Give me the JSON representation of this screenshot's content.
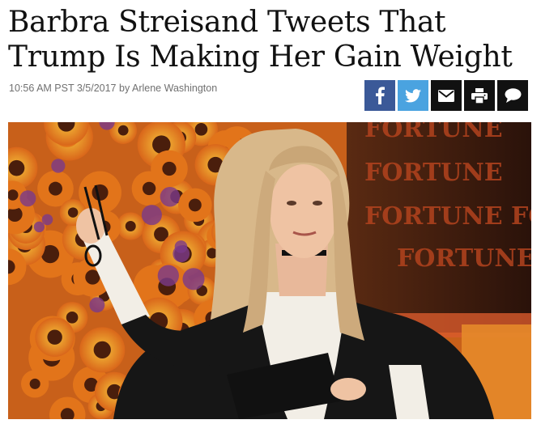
{
  "article": {
    "headline_line1": "Barbra Streisand Tweets That",
    "headline_line2": "Trump Is Making Her Gain Weight",
    "timestamp": "10:56 AM PST 3/5/2017",
    "byline_prefix": "by",
    "author": "Arlene Washington"
  },
  "share": {
    "buttons": [
      {
        "icon": "facebook-icon",
        "color": "#3b5998"
      },
      {
        "icon": "twitter-icon",
        "color": "#4aa3e0"
      },
      {
        "icon": "email-icon",
        "color": "#111111"
      },
      {
        "icon": "print-icon",
        "color": "#111111"
      },
      {
        "icon": "comment-icon",
        "color": "#111111"
      }
    ]
  },
  "photo": {
    "backdrop_text": [
      "FORTUNE",
      "FORTUNE",
      "FORTUNE FO",
      "FORTUNE"
    ],
    "colors": {
      "flower_orange": "#e2741a",
      "flower_yellow": "#f0b52a",
      "flower_center": "#4a1e0c",
      "jacket": "#161616",
      "shirt": "#f2eee6",
      "hair": "#d8b88a"
    }
  }
}
